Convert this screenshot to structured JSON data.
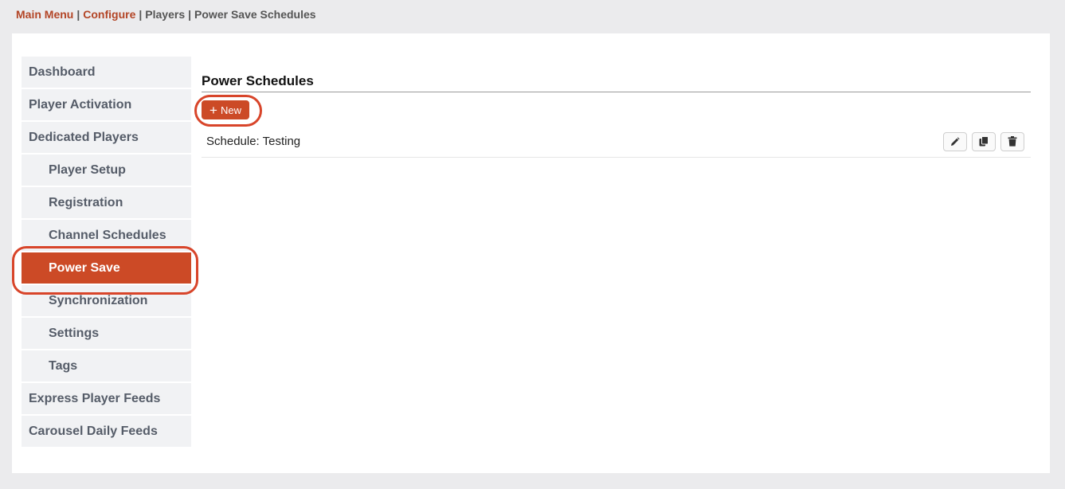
{
  "breadcrumb": {
    "items": [
      {
        "label": "Main Menu",
        "link": true
      },
      {
        "label": "Configure",
        "link": true
      },
      {
        "label": "Players",
        "link": false
      },
      {
        "label": "Power Save Schedules",
        "link": false
      }
    ],
    "separator": "|"
  },
  "sidebar": {
    "items": [
      {
        "label": "Dashboard",
        "level": 0,
        "active": false
      },
      {
        "label": "Player Activation",
        "level": 0,
        "active": false
      },
      {
        "label": "Dedicated Players",
        "level": 0,
        "active": false
      },
      {
        "label": "Player Setup",
        "level": 1,
        "active": false
      },
      {
        "label": "Registration",
        "level": 1,
        "active": false
      },
      {
        "label": "Channel Schedules",
        "level": 1,
        "active": false
      },
      {
        "label": "Power Save",
        "level": 1,
        "active": true
      },
      {
        "label": "Synchronization",
        "level": 1,
        "active": false
      },
      {
        "label": "Settings",
        "level": 1,
        "active": false
      },
      {
        "label": "Tags",
        "level": 1,
        "active": false
      },
      {
        "label": "Express Player Feeds",
        "level": 0,
        "active": false
      },
      {
        "label": "Carousel Daily Feeds",
        "level": 0,
        "active": false
      }
    ]
  },
  "main": {
    "title": "Power Schedules",
    "new_button_label": "New",
    "schedules": [
      {
        "name": "Schedule: Testing",
        "actions": [
          "pencil-icon",
          "copy-icon",
          "trash-icon"
        ]
      }
    ]
  },
  "colors": {
    "accent": "#cc4a26",
    "highlight_ring": "#d8452a",
    "sidebar_bg": "#f1f2f4",
    "page_bg": "#ebebed"
  }
}
